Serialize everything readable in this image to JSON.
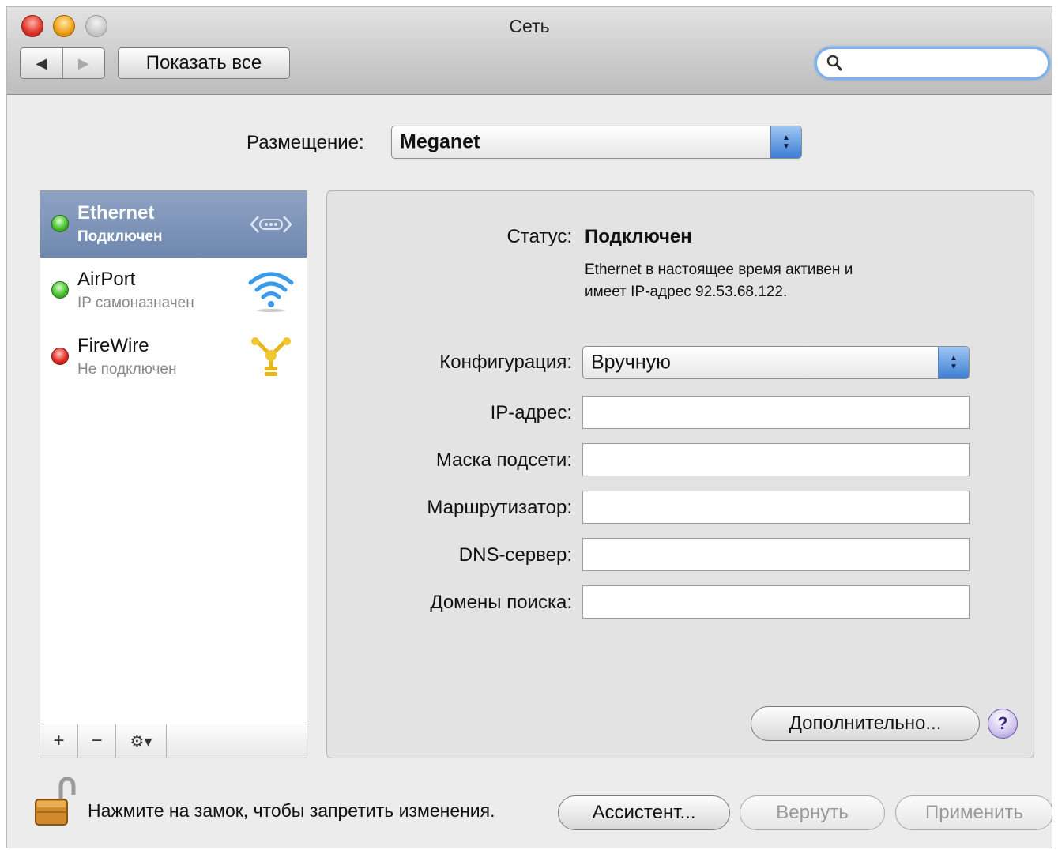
{
  "window": {
    "title": "Сеть"
  },
  "toolbar": {
    "back_glyph": "◀",
    "forward_glyph": "▶",
    "show_all_label": "Показать все",
    "search_value": "",
    "search_placeholder": ""
  },
  "location": {
    "label": "Размещение:",
    "value": "Meganet"
  },
  "services": [
    {
      "name": "Ethernet",
      "status": "Подключен",
      "state": "connected",
      "icon": "ethernet-icon",
      "selected": true
    },
    {
      "name": "AirPort",
      "status": "IP самоназначен",
      "state": "connected",
      "icon": "wifi-icon",
      "selected": false
    },
    {
      "name": "FireWire",
      "status": "Не подключен",
      "state": "disconnected",
      "icon": "firewire-icon",
      "selected": false
    }
  ],
  "sidebar_bar": {
    "add": "+",
    "remove": "−",
    "gear": "⚙▾"
  },
  "detail": {
    "status_label": "Статус:",
    "status_value": "Подключен",
    "status_desc_line1": "Ethernet в настоящее время активен и",
    "status_desc_line2": "имеет IP-адрес 92.53.68.122.",
    "config_label": "Конфигурация:",
    "config_value": "Вручную",
    "ip_label": "IP-адрес:",
    "ip_value": "",
    "mask_label": "Маска подсети:",
    "mask_value": "",
    "router_label": "Маршрутизатор:",
    "router_value": "",
    "dns_label": "DNS-сервер:",
    "dns_value": "",
    "domains_label": "Домены поиска:",
    "domains_value": "",
    "advanced_label": "Дополнительно...",
    "help_label": "?"
  },
  "footer": {
    "lock_text": "Нажмите на замок, чтобы запретить изменения.",
    "assistant_label": "Ассистент...",
    "revert_label": "Вернуть",
    "apply_label": "Применить"
  },
  "colors": {
    "selection": "#7b92b8",
    "status_green": "#46c02c",
    "status_red": "#e02a20",
    "search_focus": "#7fb0ea",
    "popup_arrows": "#3d7ed4"
  }
}
